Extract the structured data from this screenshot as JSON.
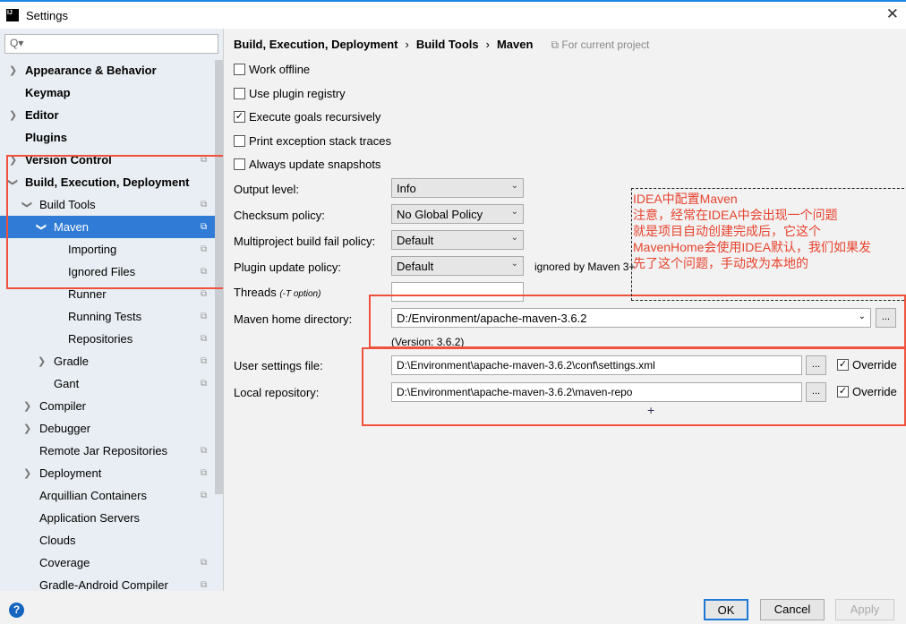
{
  "window": {
    "title": "Settings",
    "logo": "IJ"
  },
  "search": {
    "placeholder": "Q▾"
  },
  "sidebar": {
    "items": [
      {
        "label": "Appearance & Behavior",
        "level": 0,
        "arrow": "›",
        "bold": true,
        "copy": false
      },
      {
        "label": "Keymap",
        "level": 0,
        "arrow": "",
        "bold": true,
        "copy": false
      },
      {
        "label": "Editor",
        "level": 0,
        "arrow": "›",
        "bold": true,
        "copy": false
      },
      {
        "label": "Plugins",
        "level": 0,
        "arrow": "",
        "bold": true,
        "copy": false
      },
      {
        "label": "Version Control",
        "level": 0,
        "arrow": "›",
        "bold": true,
        "copy": true
      },
      {
        "label": "Build, Execution, Deployment",
        "level": 0,
        "arrow": "⌄",
        "bold": true,
        "copy": false
      },
      {
        "label": "Build Tools",
        "level": 1,
        "arrow": "⌄",
        "bold": false,
        "copy": true
      },
      {
        "label": "Maven",
        "level": 2,
        "arrow": "⌄",
        "bold": false,
        "copy": true,
        "selected": true
      },
      {
        "label": "Importing",
        "level": 3,
        "arrow": "",
        "bold": false,
        "copy": true
      },
      {
        "label": "Ignored Files",
        "level": 3,
        "arrow": "",
        "bold": false,
        "copy": true
      },
      {
        "label": "Runner",
        "level": 3,
        "arrow": "",
        "bold": false,
        "copy": true
      },
      {
        "label": "Running Tests",
        "level": 3,
        "arrow": "",
        "bold": false,
        "copy": true
      },
      {
        "label": "Repositories",
        "level": 3,
        "arrow": "",
        "bold": false,
        "copy": true
      },
      {
        "label": "Gradle",
        "level": 2,
        "arrow": "›",
        "bold": false,
        "copy": true
      },
      {
        "label": "Gant",
        "level": 2,
        "arrow": "",
        "bold": false,
        "copy": true
      },
      {
        "label": "Compiler",
        "level": 1,
        "arrow": "›",
        "bold": false,
        "copy": false
      },
      {
        "label": "Debugger",
        "level": 1,
        "arrow": "›",
        "bold": false,
        "copy": false
      },
      {
        "label": "Remote Jar Repositories",
        "level": 1,
        "arrow": "",
        "bold": false,
        "copy": true
      },
      {
        "label": "Deployment",
        "level": 1,
        "arrow": "›",
        "bold": false,
        "copy": true
      },
      {
        "label": "Arquillian Containers",
        "level": 1,
        "arrow": "",
        "bold": false,
        "copy": true
      },
      {
        "label": "Application Servers",
        "level": 1,
        "arrow": "",
        "bold": false,
        "copy": false
      },
      {
        "label": "Clouds",
        "level": 1,
        "arrow": "",
        "bold": false,
        "copy": false
      },
      {
        "label": "Coverage",
        "level": 1,
        "arrow": "",
        "bold": false,
        "copy": true
      },
      {
        "label": "Gradle-Android Compiler",
        "level": 1,
        "arrow": "",
        "bold": false,
        "copy": true
      }
    ]
  },
  "breadcrumb": {
    "items": [
      "Build, Execution, Deployment",
      "Build Tools",
      "Maven"
    ],
    "separator": "›",
    "scope": "For current project"
  },
  "checkboxes": [
    {
      "label": "Work offline",
      "checked": false
    },
    {
      "label": "Use plugin registry",
      "checked": false
    },
    {
      "label": "Execute goals recursively",
      "checked": true
    },
    {
      "label": "Print exception stack traces",
      "checked": false
    },
    {
      "label": "Always update snapshots",
      "checked": false
    }
  ],
  "selects": [
    {
      "label": "Output level:",
      "value": "Info"
    },
    {
      "label": "Checksum policy:",
      "value": "No Global Policy"
    },
    {
      "label": "Multiproject build fail policy:",
      "value": "Default"
    },
    {
      "label": "Plugin update policy:",
      "value": "Default",
      "hint": "ignored by Maven 3+"
    }
  ],
  "threads": {
    "label": "Threads",
    "hint": "(-T option)",
    "value": ""
  },
  "maven_home": {
    "label": "Maven home directory:",
    "value": "D:/Environment/apache-maven-3.6.2",
    "version": "(Version: 3.6.2)"
  },
  "user_settings": {
    "label": "User settings file:",
    "value": "D:\\Environment\\apache-maven-3.6.2\\conf\\settings.xml",
    "override": "Override",
    "checked": true
  },
  "local_repo": {
    "label": "Local repository:",
    "value": "D:\\Environment\\apache-maven-3.6.2\\maven-repo",
    "override": "Override",
    "checked": true
  },
  "browse_label": "...",
  "annotation": {
    "lines": [
      "IDEA中配置Maven",
      "注意，经常在IDEA中会出现一个问题",
      "就是项目自动创建完成后，它这个",
      "MavenHome会使用IDEA默认，我们如果发",
      "先了这个问题，手动改为本地的"
    ],
    "color": "#e8432e"
  },
  "footer": {
    "help": "?",
    "ok": "OK",
    "cancel": "Cancel",
    "apply": "Apply"
  },
  "colors": {
    "accent": "#2f7bd6",
    "highlight": "#f0513d"
  }
}
